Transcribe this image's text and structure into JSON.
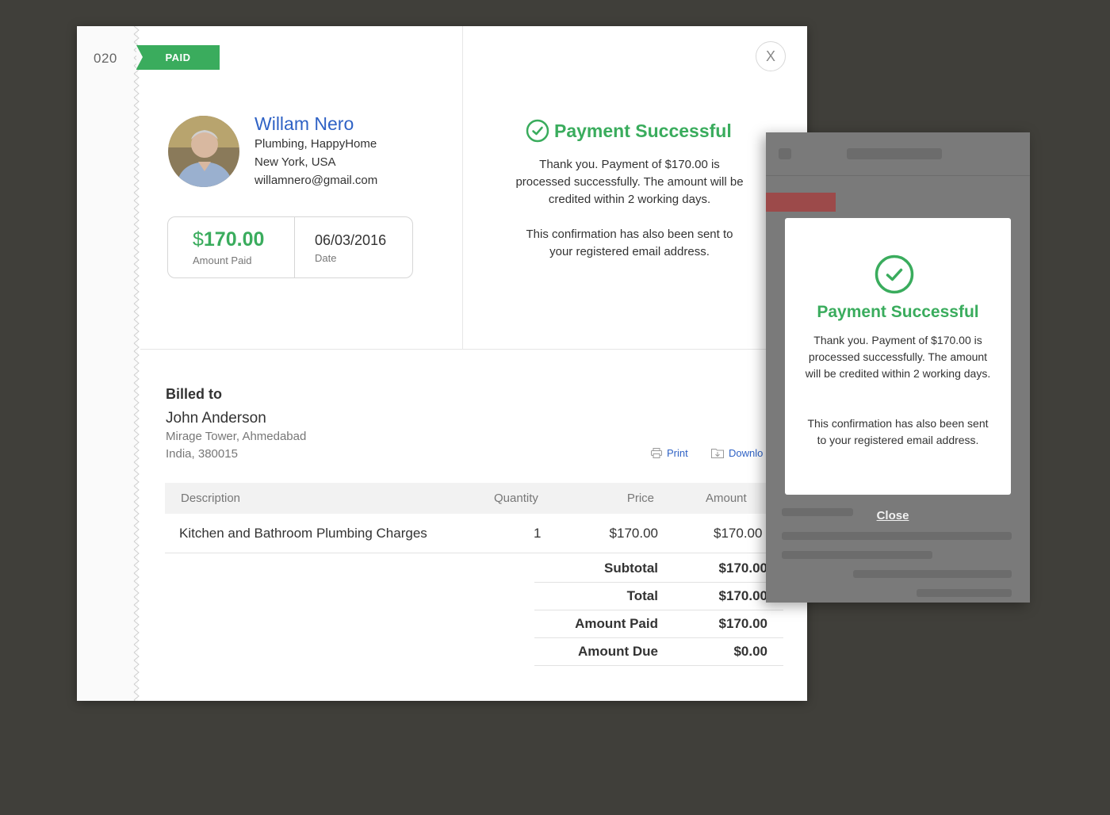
{
  "invoice": {
    "number": "020",
    "status": "PAID",
    "close_label": "X"
  },
  "vendor": {
    "name": "Willam Nero",
    "service": "Plumbing, HappyHome",
    "location": "New York, USA",
    "email": "willamnero@gmail.com"
  },
  "payment": {
    "currency_symbol": "$",
    "amount": "170.00",
    "amount_label": "Amount Paid",
    "date": "06/03/2016",
    "date_label": "Date"
  },
  "success": {
    "title": "Payment Successful",
    "message": "Thank you. Payment of $170.00 is processed successfully. The amount will be credited within 2 working days.",
    "confirmation": "This confirmation has also been sent to your registered email address."
  },
  "billed_to": {
    "heading": "Billed to",
    "name": "John Anderson",
    "address_line1": "Mirage Tower, Ahmedabad",
    "address_line2": "India, 380015"
  },
  "actions": {
    "print_label": "Print",
    "download_label": "Downlo"
  },
  "table": {
    "headers": [
      "Description",
      "Quantity",
      "Price",
      "Amount"
    ],
    "rows": [
      [
        "Kitchen and Bathroom Plumbing Charges",
        "1",
        "$170.00",
        "$170.00"
      ]
    ]
  },
  "totals": [
    {
      "label": "Subtotal",
      "value": "$170.00"
    },
    {
      "label": "Total",
      "value": "$170.00"
    },
    {
      "label": "Amount Paid",
      "value": "$170.00"
    },
    {
      "label": "Amount Due",
      "value": "$0.00"
    }
  ],
  "mobile": {
    "dialog_title": "Payment Successful",
    "dialog_message": "Thank you. Payment of $170.00 is processed successfully. The amount will be credited within 2 working days.",
    "dialog_confirmation": "This confirmation has also been sent to your registered email address.",
    "close_label": "Close"
  },
  "colors": {
    "background": "#403f3a",
    "accent_green": "#3aac5d",
    "link_blue": "#2f62c5",
    "overlay_gray": "#7a7a7a"
  },
  "icons": [
    "check-circle-icon",
    "printer-icon",
    "folder-download-icon",
    "close-icon"
  ]
}
